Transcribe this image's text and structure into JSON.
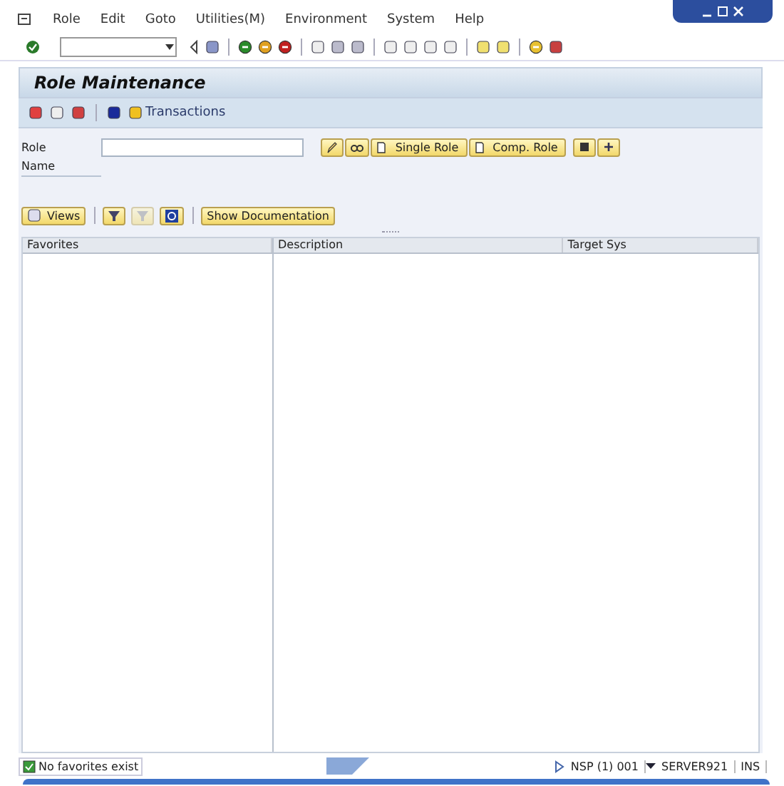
{
  "menu": [
    "Role",
    "Edit",
    "Goto",
    "Utilities(M)",
    "Environment",
    "System",
    "Help"
  ],
  "title": "Role Maintenance",
  "app_toolbar": {
    "transactions": "Transactions"
  },
  "form": {
    "role_label": "Role",
    "name_label": "Name",
    "buttons": [
      "Single Role",
      "Comp. Role"
    ]
  },
  "tree_toolbar": {
    "views": "Views",
    "documentation": "Show Documentation",
    "hide_filter_disabled": true
  },
  "columns": [
    "Favorites",
    "Description",
    "Target Sys"
  ],
  "status_bar": {
    "message": "No favorites exist",
    "system": "NSP (1) 001",
    "server": "SERVER921",
    "mode": "INS"
  }
}
